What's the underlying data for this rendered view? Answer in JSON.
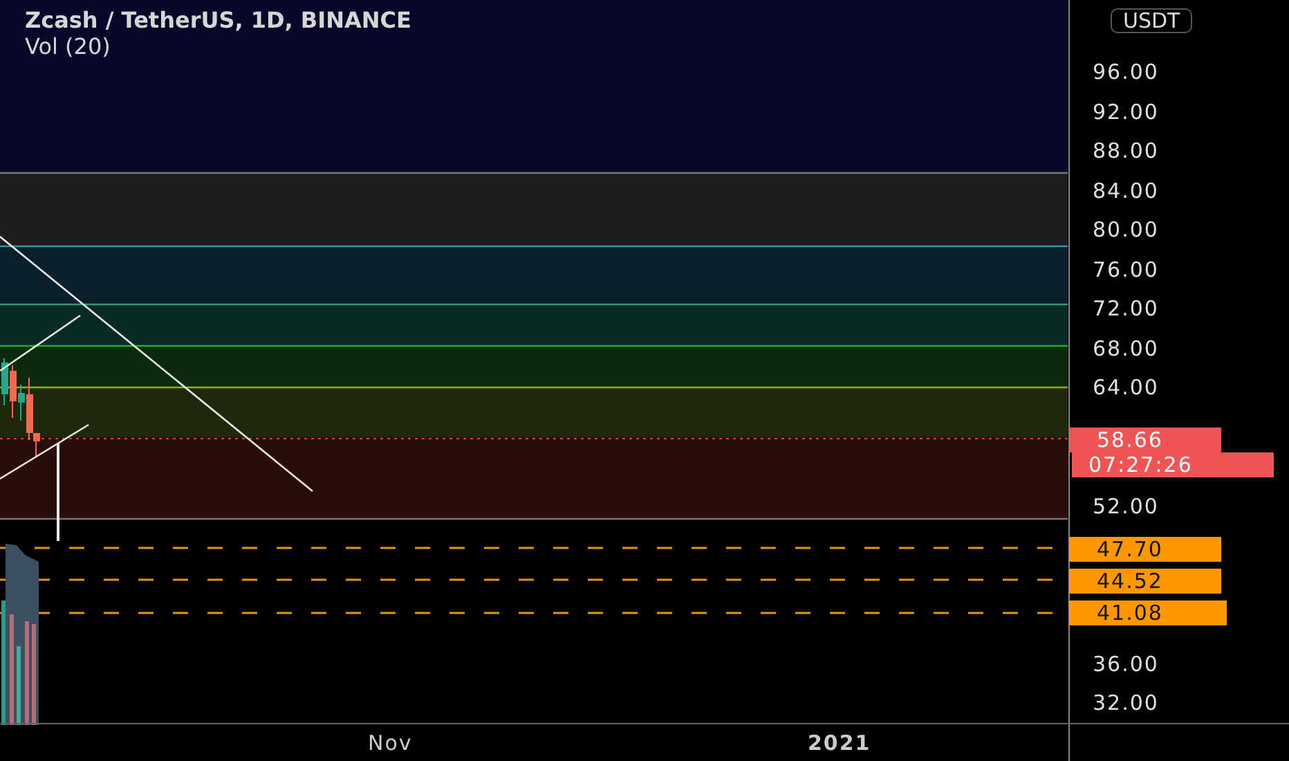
{
  "header": {
    "symbol": "Zcash / TetherUS, 1D, BINANCE",
    "indicator": "Vol (20)"
  },
  "currency": "USDT",
  "price_axis": {
    "labels": [
      "96.00",
      "92.00",
      "88.00",
      "84.00",
      "80.00",
      "76.00",
      "72.00",
      "68.00",
      "64.00",
      "52.00",
      "36.00",
      "32.00"
    ]
  },
  "price_tags": [
    {
      "kind": "last",
      "text": "58.66"
    },
    {
      "kind": "countdown",
      "text": "07:27:26"
    },
    {
      "kind": "alert",
      "text": "47.70"
    },
    {
      "kind": "alert",
      "text": "44.52"
    },
    {
      "kind": "alert",
      "text": "41.08"
    }
  ],
  "time_axis": {
    "labels": [
      "Nov",
      "2021"
    ]
  }
}
